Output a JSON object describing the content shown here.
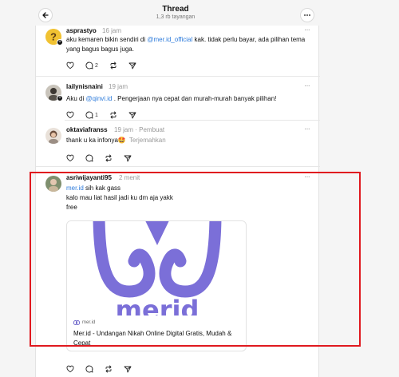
{
  "header": {
    "title": "Thread",
    "subtitle": "1,3 rb tayangan"
  },
  "posts": [
    {
      "username": "asprastyo",
      "time": "16 jam",
      "text_before": "aku kemaren bikin sendiri di ",
      "mention": "@mer.id_official",
      "text_after": " kak. tidak perlu bayar, ada pilihan tema yang bagus bagus juga.",
      "replies": "2"
    },
    {
      "username": "lailynisnaini",
      "time": "19 jam",
      "text_before": "Aku di ",
      "mention": "@qinvi.id",
      "text_after": " . Pengerjaan nya cepat dan murah-murah banyak pilihan!",
      "replies": "1"
    },
    {
      "username": "oktaviafranss",
      "time": "19 jam",
      "creator_badge": "Pembuat",
      "text": "thank u ka infonya🤩",
      "translate": "Terjemahkan"
    },
    {
      "username": "asriwijayanti95",
      "time": "2 menit",
      "mention": "mer.id",
      "line1_after": " sih kak gass",
      "line2": "kalo mau liat hasil jadi ku dm aja yakk",
      "line3": "free",
      "card": {
        "domain": "mer.id",
        "title": "Mer.id - Undangan Nikah Online Digital Gratis, Mudah & Cepat",
        "logo_text": "merid"
      }
    }
  ],
  "colors": {
    "accent_link": "#2d7bdb",
    "highlight_border": "#e0191f",
    "brand_purple": "#7b6fd8"
  }
}
